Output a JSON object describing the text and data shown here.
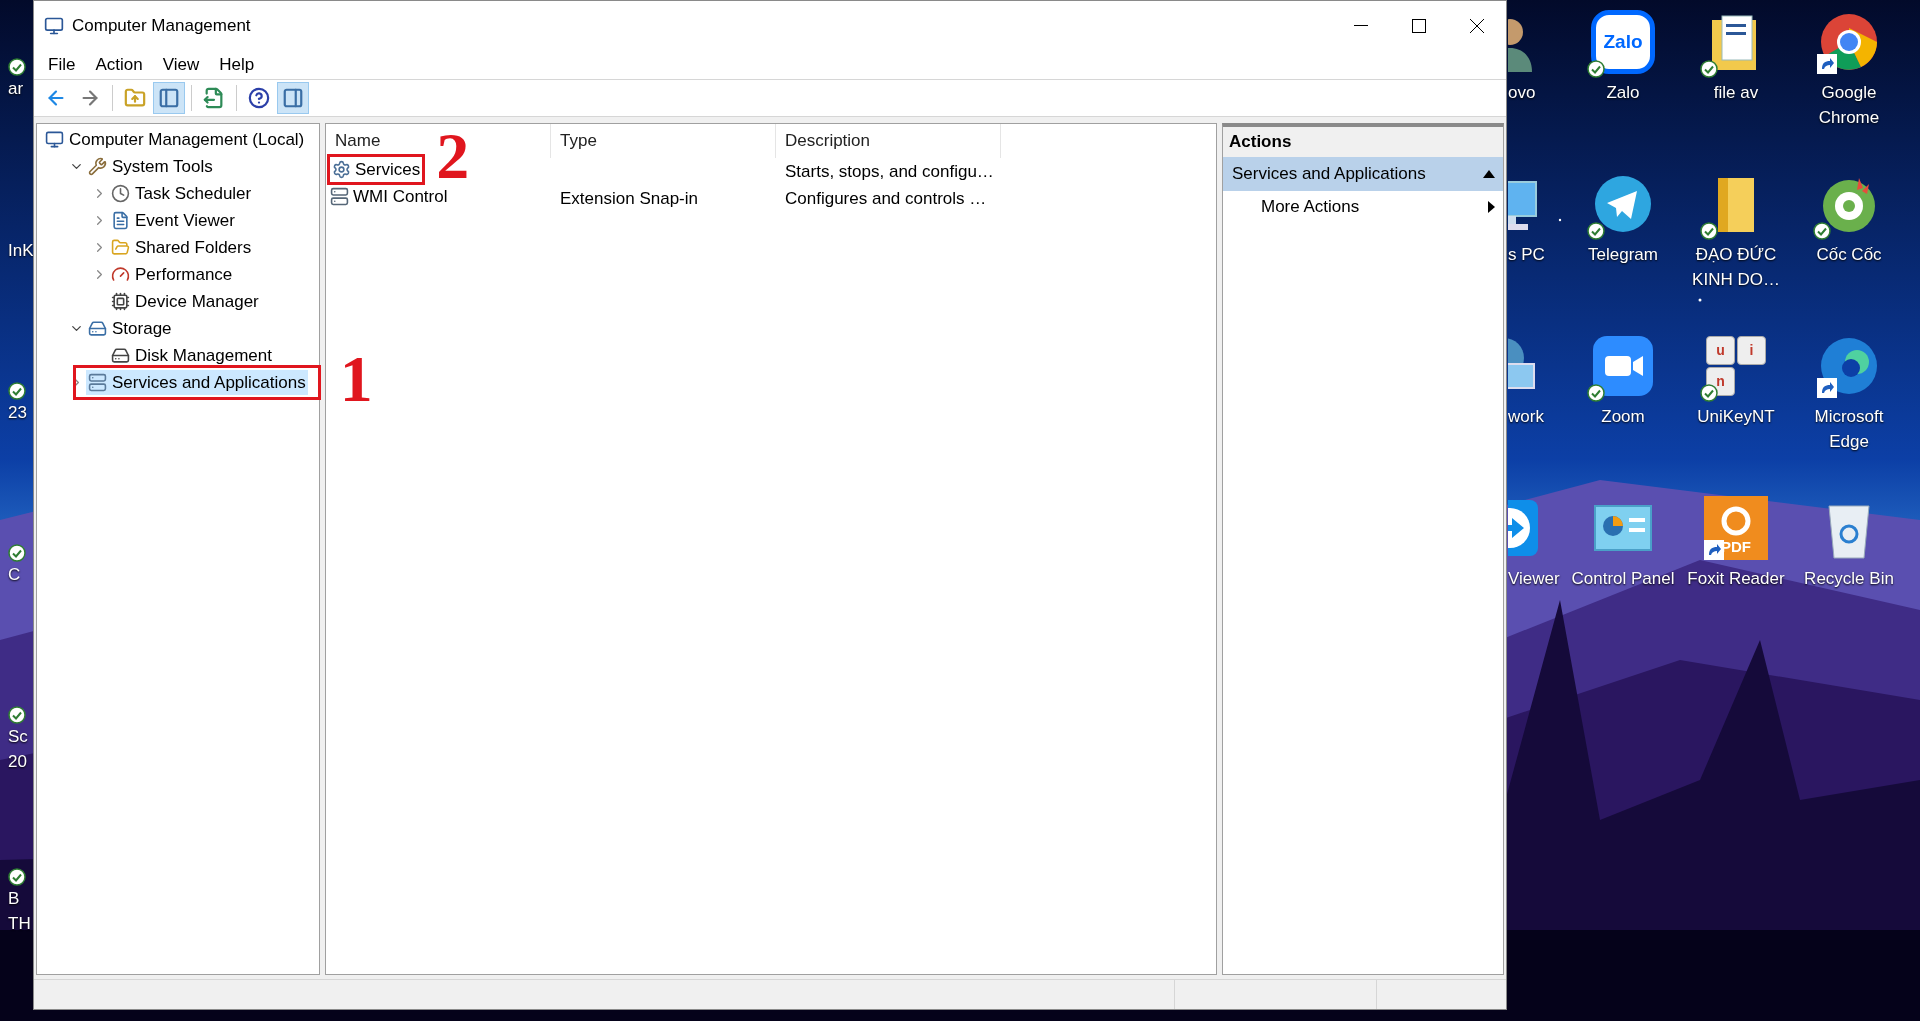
{
  "window": {
    "title": "Computer Management"
  },
  "menu": [
    "File",
    "Action",
    "View",
    "Help"
  ],
  "toolbar": [
    {
      "kind": "back",
      "pressed": false
    },
    {
      "kind": "forward",
      "pressed": false
    },
    {
      "kind": "separator"
    },
    {
      "kind": "up",
      "pressed": false
    },
    {
      "kind": "tree",
      "pressed": true
    },
    {
      "kind": "separator"
    },
    {
      "kind": "export",
      "pressed": false
    },
    {
      "kind": "separator"
    },
    {
      "kind": "help",
      "pressed": false
    },
    {
      "kind": "actions",
      "pressed": true
    }
  ],
  "tree": [
    {
      "label": "Computer Management (Local)",
      "kind": "computer",
      "selected": false,
      "children": [
        {
          "label": "System Tools",
          "kind": "tools",
          "selected": false,
          "expanded": true,
          "children": [
            {
              "label": "Task Scheduler",
              "kind": "clock",
              "selected": false,
              "expanded": false
            },
            {
              "label": "Event Viewer",
              "kind": "log",
              "selected": false,
              "expanded": false
            },
            {
              "label": "Shared Folders",
              "kind": "shared",
              "selected": false,
              "expanded": false
            },
            {
              "label": "Performance",
              "kind": "gauge",
              "selected": false,
              "expanded": false
            },
            {
              "label": "Device Manager",
              "kind": "device",
              "selected": false
            }
          ]
        },
        {
          "label": "Storage",
          "kind": "storage",
          "selected": false,
          "expanded": true,
          "children": [
            {
              "label": "Disk Management",
              "kind": "disk",
              "selected": false
            }
          ]
        },
        {
          "label": "Services and Applications",
          "kind": "services",
          "selected": true,
          "expanded": false,
          "marker": "1"
        }
      ]
    }
  ],
  "list": {
    "columns": [
      "Name",
      "Type",
      "Description"
    ],
    "rows": [
      {
        "name": "Services",
        "kind": "gear",
        "description": "Starts, stops, and configu…",
        "marker": "2"
      },
      {
        "name": "WMI Control",
        "kind": "server",
        "type": "Extension Snap-in",
        "description": "Configures and controls …"
      }
    ]
  },
  "actions": {
    "title": "Actions",
    "sections": [
      {
        "label": "Services and Applications",
        "expanded": true,
        "items": [
          {
            "label": "More Actions",
            "submenu": true
          }
        ]
      }
    ]
  },
  "desktop_left": [
    {
      "lines": [
        "ar"
      ],
      "synced": true
    },
    {
      "lines": [
        "InK"
      ],
      "synced": false
    },
    {
      "lines": [
        "23"
      ],
      "synced": true
    },
    {
      "lines": [
        "C"
      ],
      "synced": true
    },
    {
      "lines": [
        "Sc",
        "20"
      ],
      "synced": true
    },
    {
      "lines": [
        "B",
        "TH"
      ],
      "synced": true
    }
  ],
  "desktop_icons": [
    {
      "lines": [
        "ovo"
      ],
      "kind": "person",
      "synced": false,
      "shortcut": false
    },
    {
      "lines": [
        "Zalo"
      ],
      "kind": "zalo",
      "logo_text": "Zalo",
      "synced": true,
      "shortcut": false
    },
    {
      "lines": [
        "file av"
      ],
      "kind": "docfolder",
      "synced": true,
      "shortcut": false
    },
    {
      "lines": [
        "Google",
        "Chrome"
      ],
      "kind": "chrome",
      "synced": false,
      "shortcut": true
    },
    {
      "lines": [
        "s PC"
      ],
      "kind": "pc",
      "synced": false,
      "shortcut": false
    },
    {
      "lines": [
        "Telegram"
      ],
      "kind": "telegram",
      "synced": true,
      "shortcut": false
    },
    {
      "lines": [
        "ĐẠO ĐỨC",
        "KINH DO…"
      ],
      "kind": "folder",
      "synced": true,
      "shortcut": false
    },
    {
      "lines": [
        "Cốc Cốc"
      ],
      "kind": "coccoc",
      "synced": true,
      "shortcut": false
    },
    {
      "lines": [
        "work"
      ],
      "kind": "network",
      "synced": false,
      "shortcut": false
    },
    {
      "lines": [
        "Zoom"
      ],
      "kind": "zoom",
      "synced": true,
      "shortcut": false
    },
    {
      "lines": [
        "UniKeyNT"
      ],
      "kind": "unikey",
      "keys": [
        "u",
        "i",
        "n"
      ],
      "synced": true,
      "shortcut": false
    },
    {
      "lines": [
        "Microsoft",
        "Edge"
      ],
      "kind": "edge",
      "synced": false,
      "shortcut": true
    },
    {
      "lines": [
        "Viewer"
      ],
      "kind": "remote",
      "synced": false,
      "shortcut": false
    },
    {
      "lines": [
        "Control Panel"
      ],
      "kind": "panel",
      "synced": false,
      "shortcut": false
    },
    {
      "lines": [
        "Foxit Reader"
      ],
      "kind": "foxit",
      "logo_text": "PDF",
      "synced": false,
      "shortcut": true
    },
    {
      "lines": [
        "Recycle Bin"
      ],
      "kind": "bin",
      "synced": false,
      "shortcut": false
    }
  ]
}
